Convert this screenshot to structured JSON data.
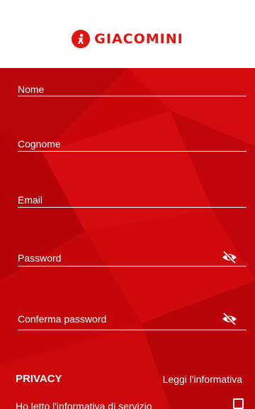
{
  "brand": {
    "name": "GIACOMINI",
    "color": "#e0140f"
  },
  "form": {
    "background": "#c9070a",
    "fields": [
      {
        "label": "Nome"
      },
      {
        "label": "Cognome"
      },
      {
        "label": "Email"
      },
      {
        "label": "Password",
        "icon": "visibility-off-icon"
      },
      {
        "label": "Conferma password",
        "icon": "visibility-off-icon"
      }
    ]
  },
  "privacy": {
    "title": "PRIVACY",
    "link_label": "Leggi l'informativa",
    "consent_label": "Ho letto l'informativa di servizio",
    "checked": false
  }
}
